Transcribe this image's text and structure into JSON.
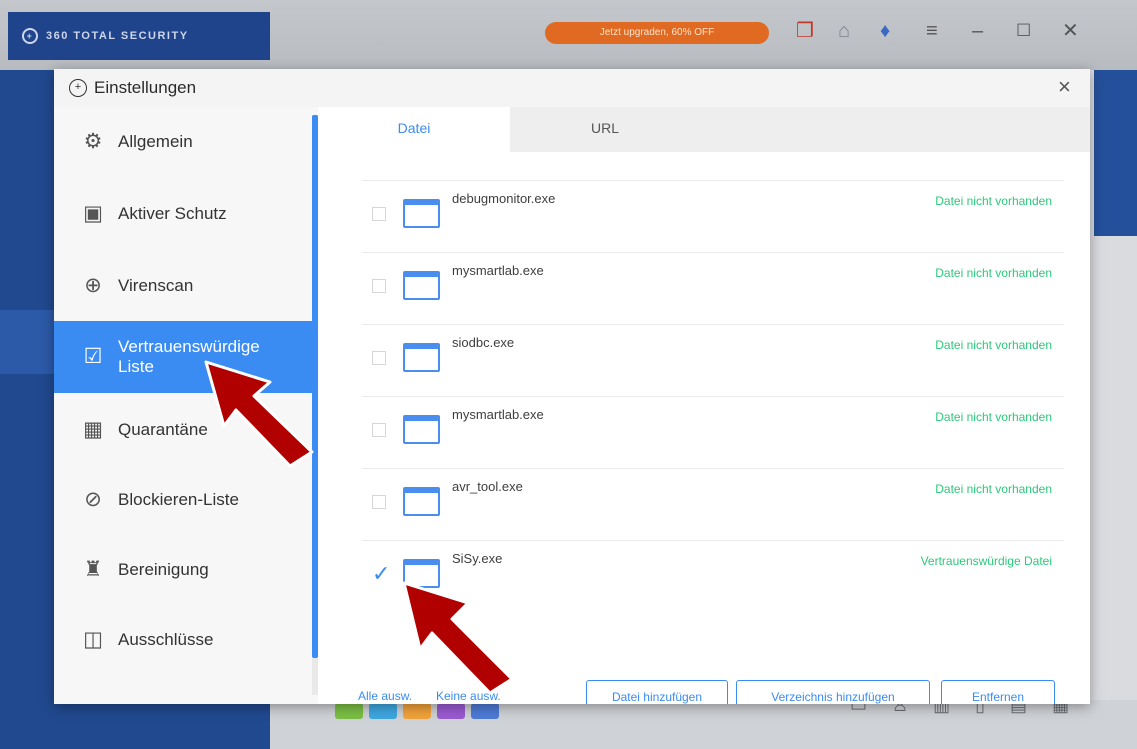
{
  "app": {
    "brand": "360 TOTAL SECURITY",
    "upgrade_label": "Jetzt upgraden, 60% OFF",
    "icons": [
      "gift-icon",
      "skin-icon",
      "shirt-icon",
      "menu-icon",
      "minimize-icon",
      "maximize-icon",
      "close-icon"
    ]
  },
  "dialog": {
    "title": "Einstellungen",
    "close_glyph": "×"
  },
  "sidebar": {
    "items": [
      {
        "label": "Allgemein",
        "icon": "gear-icon",
        "glyph": "⚙"
      },
      {
        "label": "Aktiver Schutz",
        "icon": "shield-monitor-icon",
        "glyph": "▣"
      },
      {
        "label": "Virenscan",
        "icon": "scan-icon",
        "glyph": "⊕"
      },
      {
        "label": "Vertrauenswürdige Liste",
        "icon": "trusted-list-icon",
        "glyph": "☑",
        "active": true
      },
      {
        "label": "Quarantäne",
        "icon": "quarantine-icon",
        "glyph": "▦"
      },
      {
        "label": "Blockieren-Liste",
        "icon": "block-list-icon",
        "glyph": "⊘"
      },
      {
        "label": "Bereinigung",
        "icon": "broom-icon",
        "glyph": "♜"
      },
      {
        "label": "Ausschlüsse",
        "icon": "exclusion-icon",
        "glyph": "◫"
      },
      {
        "label": "",
        "icon": "more-icon",
        "glyph": "○"
      }
    ]
  },
  "tabs": {
    "file": "Datei",
    "url": "URL"
  },
  "files": [
    {
      "name": "debugmonitor.exe",
      "status": "Datei nicht vorhanden",
      "checked": false
    },
    {
      "name": "mysmartlab.exe",
      "status": "Datei nicht vorhanden",
      "checked": false
    },
    {
      "name": "siodbc.exe",
      "status": "Datei nicht vorhanden",
      "checked": false
    },
    {
      "name": "mysmartlab.exe",
      "status": "Datei nicht vorhanden",
      "checked": false
    },
    {
      "name": "avr_tool.exe",
      "status": "Datei nicht vorhanden",
      "checked": false
    },
    {
      "name": "SiSy.exe",
      "status": "Vertrauenswürdige Datei",
      "checked": true
    }
  ],
  "footer": {
    "select_all": "Alle ausw.",
    "deselect_all": "Keine ausw.",
    "add_file": "Datei hinzufügen",
    "add_directory": "Verzeichnis hinzufügen",
    "remove": "Entfernen"
  },
  "colors": {
    "accent": "#3b8cf2",
    "status_green": "#2cc97a",
    "annotation_arrow": "#b10000"
  }
}
